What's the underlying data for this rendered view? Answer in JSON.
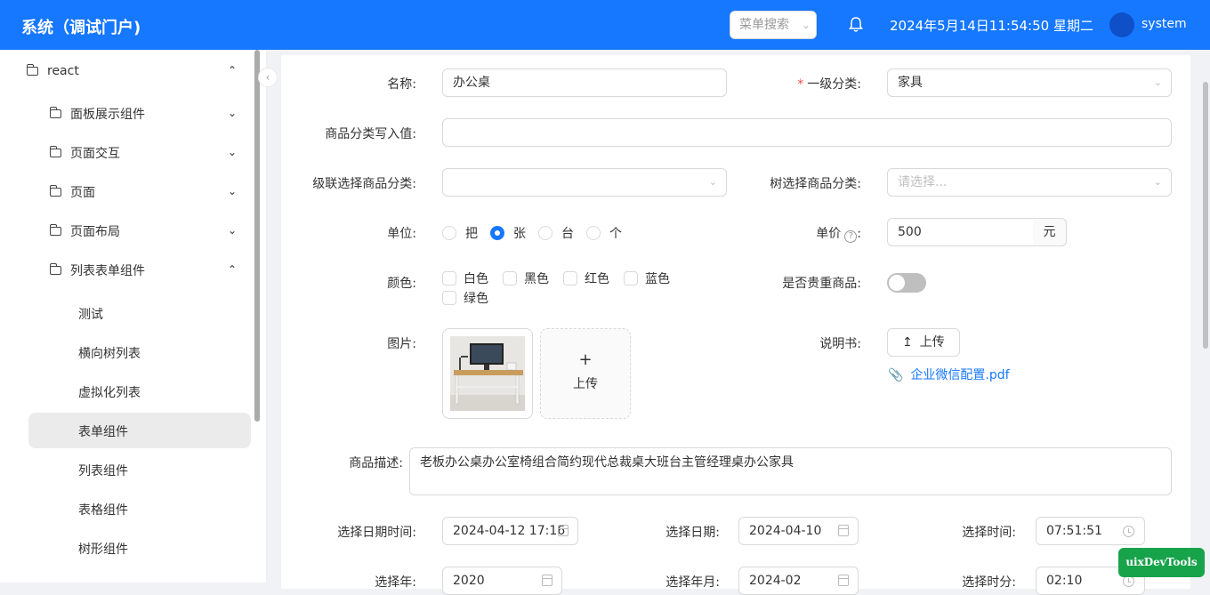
{
  "header": {
    "title": "系统（调试门户)",
    "menu_search_placeholder": "菜单搜索",
    "datetime": "2024年5月14日11:54:50 星期二",
    "username": "system"
  },
  "sidebar": {
    "root": "react",
    "groups": [
      "面板展示组件",
      "页面交互",
      "页面",
      "页面布局",
      "列表表单组件"
    ],
    "leaves": [
      "测试",
      "横向树列表",
      "虚拟化列表",
      "表单组件",
      "列表组件",
      "表格组件",
      "树形组件"
    ],
    "active_leaf": "表单组件"
  },
  "form": {
    "name_label": "名称:",
    "name_value": "办公桌",
    "category1_label": "一级分类:",
    "category1_value": "家具",
    "category_write_label": "商品分类写入值:",
    "category_write_value": "",
    "cascade_label": "级联选择商品分类:",
    "cascade_value": "",
    "tree_label": "树选择商品分类:",
    "tree_placeholder": "请选择...",
    "unit_label": "单位:",
    "unit_options": [
      "把",
      "张",
      "台",
      "个"
    ],
    "unit_selected": "张",
    "price_label": "单价",
    "price_value": "500",
    "price_suffix": "元",
    "color_label": "颜色:",
    "color_options": [
      "白色",
      "黑色",
      "红色",
      "蓝色",
      "绿色"
    ],
    "valuable_label": "是否贵重商品:",
    "valuable_on": false,
    "image_label": "图片:",
    "image_upload_label": "上传",
    "manual_label": "说明书:",
    "manual_upload_label": "上传",
    "manual_file": "企业微信配置.pdf",
    "desc_label": "商品描述:",
    "desc_value": "老板办公桌办公室椅组合简约现代总裁桌大班台主管经理桌办公家具",
    "datetime_label": "选择日期时间:",
    "datetime_value": "2024-04-12 17:16",
    "date_label": "选择日期:",
    "date_value": "2024-04-10",
    "time_label": "选择时间:",
    "time_value": "07:51:51",
    "year_label": "选择年:",
    "year_value": "2020",
    "month_label": "选择年月:",
    "month_value": "2024-02",
    "hm_label": "选择时分:",
    "hm_value": "02:10"
  },
  "devtools_label": "uixDevTools"
}
